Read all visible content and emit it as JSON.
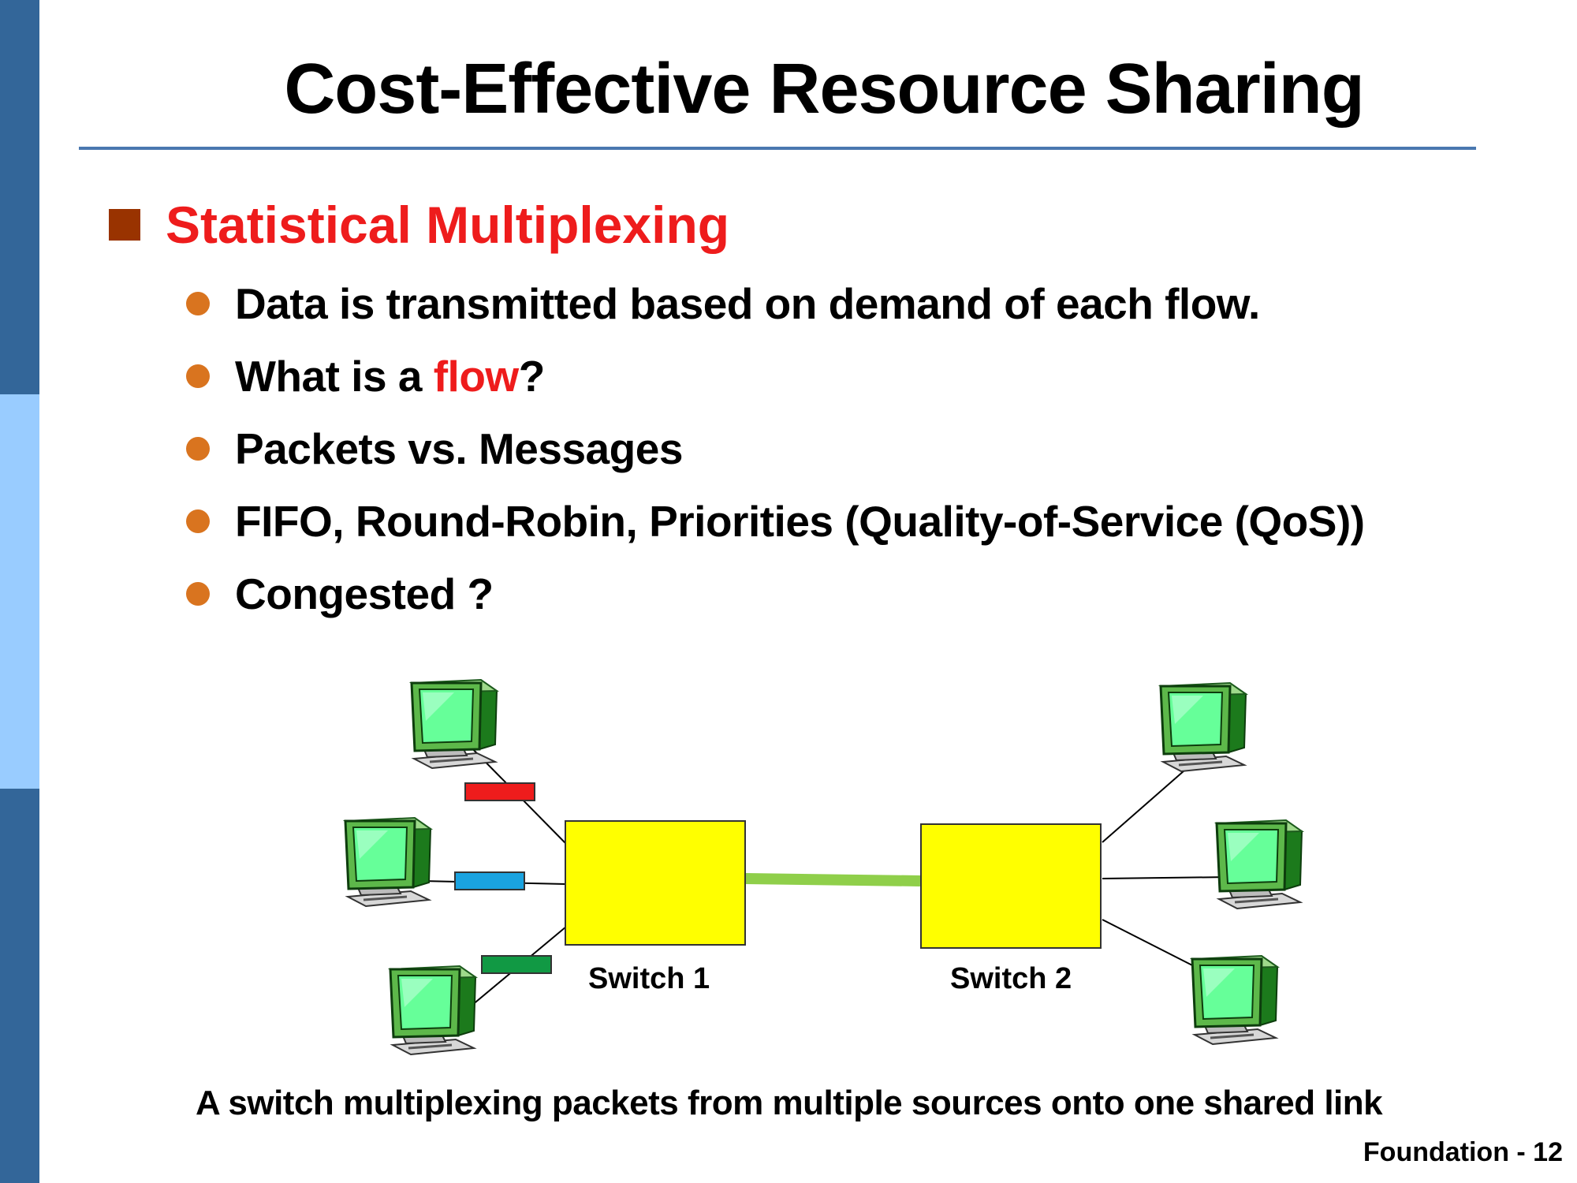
{
  "slide": {
    "title": "Cost-Effective Resource Sharing",
    "main_bullet": "Statistical Multiplexing",
    "sub_bullets": {
      "b0": "Data is transmitted based on demand of each flow.",
      "b1_pre": "What is a ",
      "b1_highlight": "flow",
      "b1_post": "?",
      "b2": "Packets vs. Messages",
      "b3": "FIFO, Round-Robin, Priorities (Quality-of-Service (QoS))",
      "b4": "Congested ?"
    },
    "diagram": {
      "switch1_label": "Switch 1",
      "switch2_label": "Switch 2",
      "packet_colors": [
        "#ee1c1c",
        "#1aa3e0",
        "#119944"
      ],
      "switch_color": "#ffff00",
      "link_color": "#8fcf4a",
      "computer_icon": "computer-icon"
    },
    "caption": "A switch multiplexing packets from multiple sources onto one shared link",
    "footer": "Foundation - 12"
  }
}
